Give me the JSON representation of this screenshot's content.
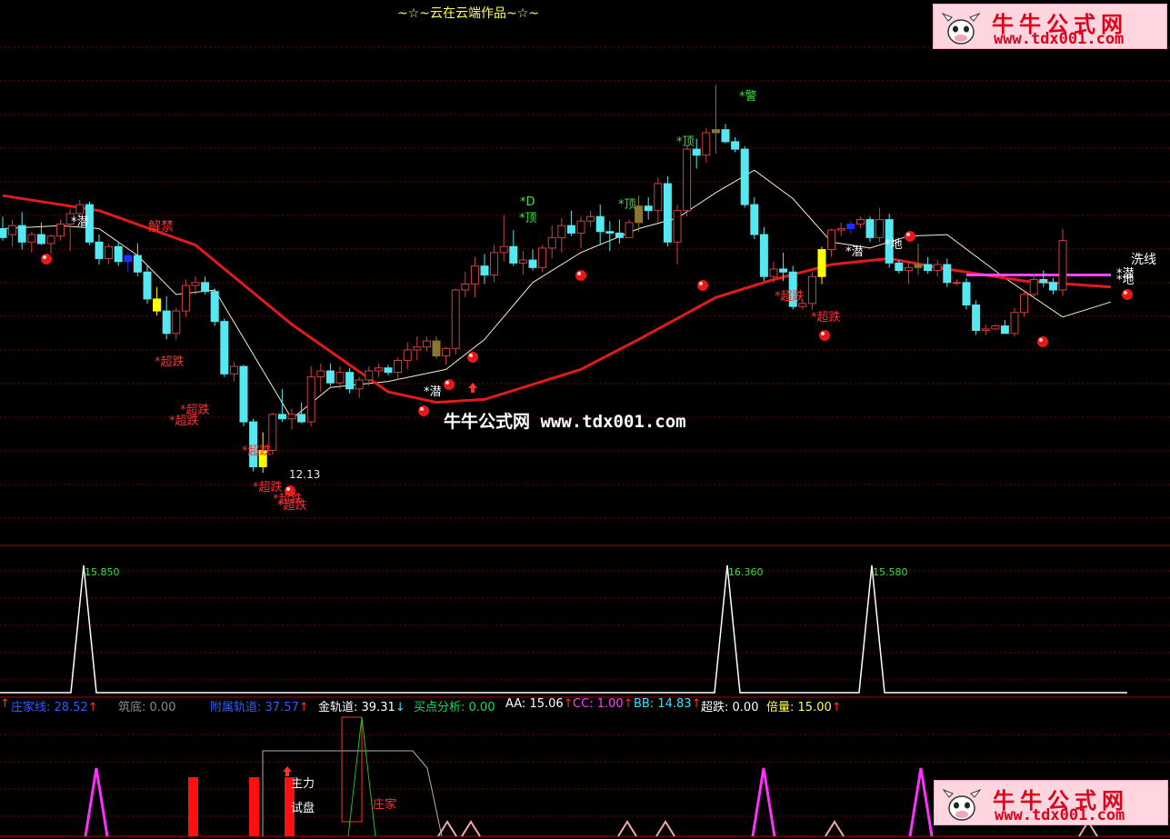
{
  "title": "~☆~云在云端作品~☆~",
  "center_watermark": "牛牛公式网 www.tdx001.com",
  "watermark": {
    "name": "牛牛公式网",
    "url": "www.tdx001.com"
  },
  "price_labels": {
    "jie_jin": "解禁",
    "low": "12.13",
    "xi_xian": "洗线",
    "chao_die": "*超跌",
    "qian": "*潜",
    "ding": "*顶",
    "jing": "*警",
    "di": "*地",
    "d": "*D"
  },
  "indicator_peaks": [
    "15.850",
    "16.360",
    "15.580"
  ],
  "status_bar": [
    {
      "label": "庄家线:",
      "value": "28.52",
      "arrow": "↑",
      "color": "#2f5cff"
    },
    {
      "label": "筑底:",
      "value": "0.00",
      "arrow": "",
      "color": "#8a8a8a"
    },
    {
      "label": "附属轨道:",
      "value": "37.57",
      "arrow": "↑",
      "color": "#2f5cff"
    },
    {
      "label": "金轨道:",
      "value": "39.31",
      "arrow": "↓",
      "color": "#ffffff"
    },
    {
      "label": "买点分析:",
      "value": "0.00",
      "arrow": "",
      "color": "#00e060"
    },
    {
      "label": "AA:",
      "value": "15.06",
      "arrow": "↑",
      "color": "#ffffff"
    },
    {
      "label": "CC:",
      "value": "1.00",
      "arrow": "↑",
      "color": "#ff40ff"
    },
    {
      "label": "BB:",
      "value": "14.83",
      "arrow": "↑",
      "color": "#3fe0ff"
    },
    {
      "label": "超跌:",
      "value": "0.00",
      "arrow": "",
      "color": "#ffffff"
    },
    {
      "label": "倍量:",
      "value": "15.00",
      "arrow": "↑",
      "color": "#ffff55"
    }
  ],
  "bottom_labels": {
    "zhuli": "主力",
    "shipan": "试盘",
    "zhuangjia": "庄家"
  },
  "colors": {
    "up": "#d04040",
    "down": "#55e8f0",
    "ma_long": "#e31a1a",
    "ma_short": "#f5f0c8",
    "grid": "#7a0000",
    "gold": "#8b7630",
    "yellow": "#ffff00"
  },
  "chart_data": [
    {
      "type": "candlestick",
      "title": "~☆~云在云端作品~☆~",
      "candles": [
        {
          "o": 28.4,
          "h": 29.2,
          "l": 27.6,
          "c": 27.8
        },
        {
          "o": 28.0,
          "h": 29.0,
          "l": 27.2,
          "c": 28.6
        },
        {
          "o": 28.6,
          "h": 29.5,
          "l": 27.0,
          "c": 27.5
        },
        {
          "o": 27.5,
          "h": 28.2,
          "l": 26.8,
          "c": 28.0
        },
        {
          "o": 28.0,
          "h": 28.8,
          "l": 27.3,
          "c": 27.4
        },
        {
          "o": 27.4,
          "h": 28.0,
          "l": 26.7,
          "c": 27.9
        },
        {
          "o": 27.9,
          "h": 29.0,
          "l": 27.6,
          "c": 28.7
        },
        {
          "o": 28.7,
          "h": 29.7,
          "l": 26.9,
          "c": 29.4
        },
        {
          "o": 29.4,
          "h": 30.3,
          "l": 29.0,
          "c": 30.0
        },
        {
          "o": 30.0,
          "h": 30.2,
          "l": 27.3,
          "c": 27.5
        },
        {
          "o": 27.5,
          "h": 28.0,
          "l": 26.0,
          "c": 26.4
        },
        {
          "o": 26.4,
          "h": 27.4,
          "l": 26.0,
          "c": 27.2
        },
        {
          "o": 27.2,
          "h": 27.5,
          "l": 25.9,
          "c": 26.2
        },
        {
          "o": 26.2,
          "h": 26.8,
          "l": 25.5,
          "c": 26.6
        },
        {
          "o": 26.6,
          "h": 27.4,
          "l": 25.2,
          "c": 25.5
        },
        {
          "o": 25.5,
          "h": 26.0,
          "l": 23.4,
          "c": 23.7
        },
        {
          "o": 23.7,
          "h": 24.5,
          "l": 22.6,
          "c": 22.9
        },
        {
          "o": 22.9,
          "h": 23.9,
          "l": 21.0,
          "c": 21.4
        },
        {
          "o": 21.4,
          "h": 23.1,
          "l": 21.0,
          "c": 22.9
        },
        {
          "o": 22.9,
          "h": 25.0,
          "l": 22.5,
          "c": 24.6
        },
        {
          "o": 24.6,
          "h": 25.2,
          "l": 24.0,
          "c": 24.8
        },
        {
          "o": 24.8,
          "h": 25.2,
          "l": 24.0,
          "c": 24.2
        },
        {
          "o": 24.2,
          "h": 24.4,
          "l": 21.9,
          "c": 22.2
        },
        {
          "o": 22.2,
          "h": 22.4,
          "l": 18.5,
          "c": 18.7
        },
        {
          "o": 18.7,
          "h": 19.5,
          "l": 18.2,
          "c": 19.2
        },
        {
          "o": 19.2,
          "h": 19.3,
          "l": 15.2,
          "c": 15.5
        },
        {
          "o": 15.5,
          "h": 15.7,
          "l": 12.2,
          "c": 12.5
        },
        {
          "o": 12.5,
          "h": 14.8,
          "l": 12.1,
          "c": 13.6
        },
        {
          "o": 13.6,
          "h": 16.1,
          "l": 13.3,
          "c": 16.0
        },
        {
          "o": 16.0,
          "h": 17.7,
          "l": 15.5,
          "c": 15.7
        },
        {
          "o": 15.7,
          "h": 16.4,
          "l": 15.0,
          "c": 16.0
        },
        {
          "o": 16.0,
          "h": 16.8,
          "l": 15.4,
          "c": 15.5
        },
        {
          "o": 15.5,
          "h": 19.2,
          "l": 15.2,
          "c": 18.5
        },
        {
          "o": 18.5,
          "h": 19.4,
          "l": 17.5,
          "c": 18.9
        },
        {
          "o": 18.9,
          "h": 19.4,
          "l": 17.9,
          "c": 18.1
        },
        {
          "o": 18.1,
          "h": 19.2,
          "l": 17.7,
          "c": 18.8
        },
        {
          "o": 18.8,
          "h": 19.1,
          "l": 17.4,
          "c": 17.7
        },
        {
          "o": 17.7,
          "h": 18.5,
          "l": 17.1,
          "c": 18.3
        },
        {
          "o": 18.3,
          "h": 19.2,
          "l": 17.9,
          "c": 18.9
        },
        {
          "o": 18.9,
          "h": 19.4,
          "l": 18.5,
          "c": 19.1
        },
        {
          "o": 19.1,
          "h": 19.3,
          "l": 18.6,
          "c": 18.8
        },
        {
          "o": 18.8,
          "h": 19.8,
          "l": 18.3,
          "c": 19.6
        },
        {
          "o": 19.6,
          "h": 20.8,
          "l": 19.0,
          "c": 20.3
        },
        {
          "o": 20.3,
          "h": 21.2,
          "l": 19.6,
          "c": 20.5
        },
        {
          "o": 20.5,
          "h": 21.2,
          "l": 20.2,
          "c": 20.9
        },
        {
          "o": 20.9,
          "h": 21.2,
          "l": 19.7,
          "c": 19.9
        },
        {
          "o": 19.9,
          "h": 20.5,
          "l": 19.3,
          "c": 20.4
        },
        {
          "o": 20.4,
          "h": 24.4,
          "l": 20.0,
          "c": 24.3
        },
        {
          "o": 24.3,
          "h": 25.5,
          "l": 23.8,
          "c": 24.7
        },
        {
          "o": 24.7,
          "h": 26.5,
          "l": 23.8,
          "c": 25.9
        },
        {
          "o": 25.9,
          "h": 26.7,
          "l": 24.7,
          "c": 25.3
        },
        {
          "o": 25.3,
          "h": 27.3,
          "l": 24.8,
          "c": 26.8
        },
        {
          "o": 26.8,
          "h": 29.3,
          "l": 26.2,
          "c": 27.2
        },
        {
          "o": 27.2,
          "h": 28.3,
          "l": 25.9,
          "c": 26.1
        },
        {
          "o": 26.1,
          "h": 26.9,
          "l": 25.3,
          "c": 26.3
        },
        {
          "o": 26.3,
          "h": 27.0,
          "l": 25.6,
          "c": 25.8
        },
        {
          "o": 25.8,
          "h": 27.3,
          "l": 25.5,
          "c": 27.1
        },
        {
          "o": 27.1,
          "h": 28.6,
          "l": 26.4,
          "c": 27.8
        },
        {
          "o": 27.8,
          "h": 29.1,
          "l": 26.8,
          "c": 28.6
        },
        {
          "o": 28.6,
          "h": 29.6,
          "l": 27.9,
          "c": 28.1
        },
        {
          "o": 28.1,
          "h": 29.2,
          "l": 27.1,
          "c": 28.9
        },
        {
          "o": 28.9,
          "h": 29.6,
          "l": 28.5,
          "c": 29.2
        },
        {
          "o": 29.2,
          "h": 30.0,
          "l": 27.3,
          "c": 28.2
        },
        {
          "o": 28.2,
          "h": 28.9,
          "l": 26.9,
          "c": 28.1
        },
        {
          "o": 28.1,
          "h": 29.0,
          "l": 27.4,
          "c": 27.8
        },
        {
          "o": 27.8,
          "h": 29.0,
          "l": 28.0,
          "c": 28.8
        },
        {
          "o": 28.8,
          "h": 30.6,
          "l": 28.2,
          "c": 29.9
        },
        {
          "o": 29.9,
          "h": 30.5,
          "l": 29.0,
          "c": 29.6
        },
        {
          "o": 29.6,
          "h": 31.8,
          "l": 28.8,
          "c": 31.4
        },
        {
          "o": 31.4,
          "h": 31.9,
          "l": 27.2,
          "c": 27.5
        },
        {
          "o": 27.5,
          "h": 30.0,
          "l": 26.0,
          "c": 29.6
        },
        {
          "o": 29.6,
          "h": 34.0,
          "l": 29.2,
          "c": 33.7
        },
        {
          "o": 33.7,
          "h": 34.4,
          "l": 32.4,
          "c": 33.3
        },
        {
          "o": 33.3,
          "h": 35.1,
          "l": 32.8,
          "c": 34.8
        },
        {
          "o": 34.8,
          "h": 38.0,
          "l": 33.4,
          "c": 35.0
        },
        {
          "o": 35.0,
          "h": 35.4,
          "l": 34.1,
          "c": 34.2
        },
        {
          "o": 34.2,
          "h": 34.5,
          "l": 33.5,
          "c": 33.7
        },
        {
          "o": 33.7,
          "h": 33.9,
          "l": 29.8,
          "c": 30.0
        },
        {
          "o": 30.0,
          "h": 30.5,
          "l": 27.7,
          "c": 28.0
        },
        {
          "o": 28.0,
          "h": 28.5,
          "l": 24.9,
          "c": 25.2
        },
        {
          "o": 25.2,
          "h": 26.2,
          "l": 24.8,
          "c": 25.7
        },
        {
          "o": 25.7,
          "h": 26.8,
          "l": 24.9,
          "c": 25.5
        },
        {
          "o": 25.5,
          "h": 25.9,
          "l": 23.0,
          "c": 23.2
        },
        {
          "o": 23.2,
          "h": 23.6,
          "l": 23.0,
          "c": 23.4
        },
        {
          "o": 23.4,
          "h": 25.5,
          "l": 23.0,
          "c": 25.2
        },
        {
          "o": 25.2,
          "h": 27.2,
          "l": 24.7,
          "c": 27.0
        },
        {
          "o": 27.0,
          "h": 28.4,
          "l": 26.5,
          "c": 28.3
        },
        {
          "o": 28.3,
          "h": 28.8,
          "l": 27.9,
          "c": 28.4
        },
        {
          "o": 28.4,
          "h": 28.9,
          "l": 28.0,
          "c": 28.7
        },
        {
          "o": 28.7,
          "h": 29.2,
          "l": 28.4,
          "c": 29.0
        },
        {
          "o": 29.0,
          "h": 29.2,
          "l": 27.5,
          "c": 27.8
        },
        {
          "o": 27.8,
          "h": 29.8,
          "l": 27.5,
          "c": 29.0
        },
        {
          "o": 29.0,
          "h": 29.4,
          "l": 25.8,
          "c": 26.1
        },
        {
          "o": 26.1,
          "h": 26.3,
          "l": 25.4,
          "c": 25.6
        },
        {
          "o": 25.6,
          "h": 26.2,
          "l": 24.7,
          "c": 25.8
        },
        {
          "o": 25.8,
          "h": 27.4,
          "l": 25.3,
          "c": 26.0
        },
        {
          "o": 26.0,
          "h": 26.5,
          "l": 25.4,
          "c": 25.6
        },
        {
          "o": 25.6,
          "h": 26.3,
          "l": 25.2,
          "c": 26.0
        },
        {
          "o": 26.0,
          "h": 26.4,
          "l": 24.5,
          "c": 24.8
        },
        {
          "o": 24.8,
          "h": 25.0,
          "l": 24.6,
          "c": 24.8
        },
        {
          "o": 24.8,
          "h": 25.1,
          "l": 23.0,
          "c": 23.3
        },
        {
          "o": 23.3,
          "h": 23.6,
          "l": 21.3,
          "c": 21.6
        },
        {
          "o": 21.6,
          "h": 22.0,
          "l": 21.3,
          "c": 21.7
        },
        {
          "o": 21.7,
          "h": 22.0,
          "l": 21.6,
          "c": 21.9
        },
        {
          "o": 21.9,
          "h": 22.3,
          "l": 21.5,
          "c": 21.4
        },
        {
          "o": 21.4,
          "h": 23.1,
          "l": 21.2,
          "c": 22.8
        },
        {
          "o": 22.8,
          "h": 24.3,
          "l": 22.5,
          "c": 24.0
        },
        {
          "o": 24.0,
          "h": 25.4,
          "l": 23.7,
          "c": 25.0
        },
        {
          "o": 25.0,
          "h": 25.6,
          "l": 24.5,
          "c": 24.8
        },
        {
          "o": 24.8,
          "h": 25.1,
          "l": 24.0,
          "c": 24.3
        },
        {
          "o": 24.3,
          "h": 28.4,
          "l": 23.9,
          "c": 27.6
        }
      ],
      "special_candles": {
        "yellow": [
          16,
          27,
          85
        ],
        "blue": [
          13,
          88,
          115
        ],
        "gold": [
          45,
          66,
          74,
          95
        ]
      },
      "ma_long": [
        [
          0,
          30.6
        ],
        [
          10,
          29.6
        ],
        [
          20,
          27.3
        ],
        [
          30,
          22.0
        ],
        [
          40,
          17.5
        ],
        [
          45,
          16.8
        ],
        [
          50,
          17.0
        ],
        [
          55,
          18.0
        ],
        [
          60,
          19.0
        ],
        [
          66,
          21.0
        ],
        [
          74,
          23.8
        ],
        [
          80,
          25.0
        ],
        [
          86,
          26.0
        ],
        [
          92,
          26.4
        ],
        [
          98,
          25.7
        ],
        [
          106,
          24.9
        ],
        [
          115,
          24.5
        ]
      ],
      "ma_short": [
        [
          0,
          28.4
        ],
        [
          6,
          28.6
        ],
        [
          10,
          28.4
        ],
        [
          14,
          26.6
        ],
        [
          18,
          24.0
        ],
        [
          22,
          24.3
        ],
        [
          26,
          20.0
        ],
        [
          30,
          15.7
        ],
        [
          34,
          17.8
        ],
        [
          40,
          18.2
        ],
        [
          46,
          19.0
        ],
        [
          50,
          21.0
        ],
        [
          55,
          24.8
        ],
        [
          60,
          26.8
        ],
        [
          66,
          28.4
        ],
        [
          70,
          29.1
        ],
        [
          74,
          30.8
        ],
        [
          78,
          32.3
        ],
        [
          82,
          30.4
        ],
        [
          86,
          27.5
        ],
        [
          90,
          27.1
        ],
        [
          94,
          27.9
        ],
        [
          98,
          28.0
        ],
        [
          104,
          25.1
        ],
        [
          110,
          22.5
        ],
        [
          115,
          23.5
        ]
      ],
      "resistance_line": {
        "from": 100,
        "to": 115,
        "value": 25.3
      },
      "low_label_value": 12.13
    },
    {
      "type": "line",
      "series": [
        {
          "values": [
            0,
            15.85,
            0,
            0,
            16.36,
            0,
            15.58,
            0
          ]
        }
      ],
      "peak_labels": [
        "15.850",
        "16.360",
        "15.580"
      ]
    }
  ]
}
